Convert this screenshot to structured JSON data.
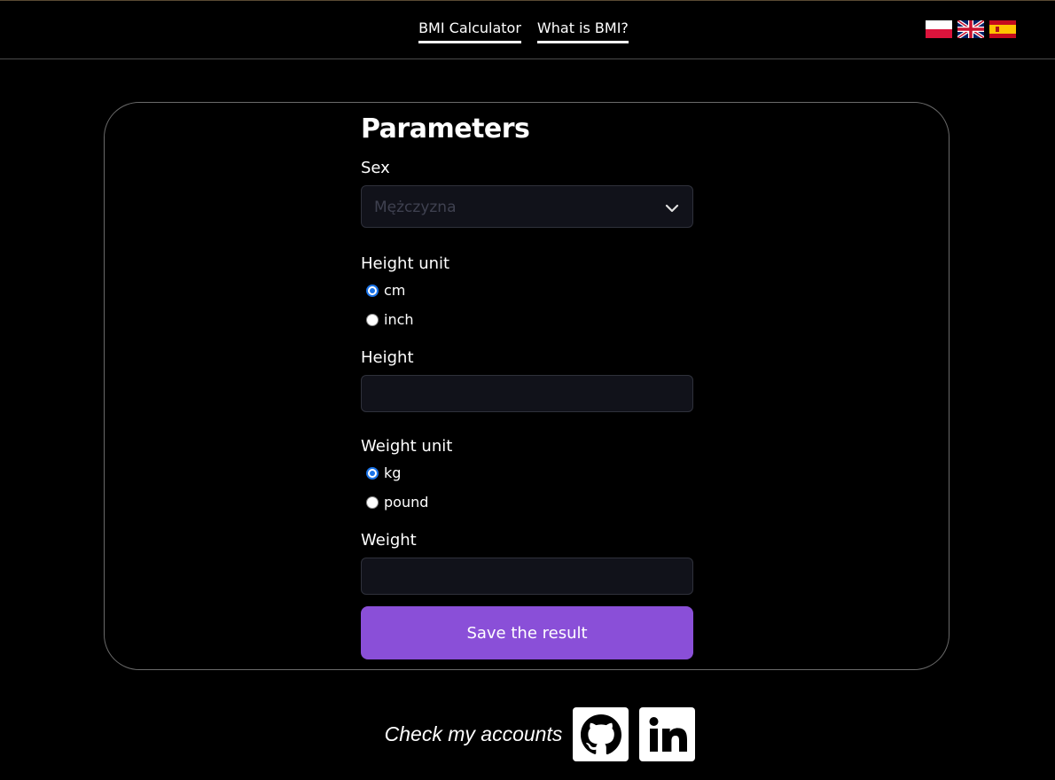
{
  "nav": {
    "items": [
      {
        "label": "BMI Calculator"
      },
      {
        "label": "What is BMI?"
      }
    ]
  },
  "flags": [
    "flag-pl-icon",
    "flag-uk-icon",
    "flag-es-icon"
  ],
  "form": {
    "title": "Parameters",
    "sex": {
      "label": "Sex",
      "selected": "Mężczyzna"
    },
    "height_unit": {
      "label": "Height unit",
      "options": [
        "cm",
        "inch"
      ],
      "selected": "cm"
    },
    "height": {
      "label": "Height",
      "value": ""
    },
    "weight_unit": {
      "label": "Weight unit",
      "options": [
        "kg",
        "pound"
      ],
      "selected": "kg"
    },
    "weight": {
      "label": "Weight",
      "value": ""
    },
    "save_label": "Save the result"
  },
  "footer": {
    "text": "Check my accounts",
    "links": [
      "github-icon",
      "linkedin-icon"
    ]
  },
  "colors": {
    "accent": "#8a4fd8",
    "radio_checked": "#1a73e8",
    "input_bg": "#11121a"
  }
}
